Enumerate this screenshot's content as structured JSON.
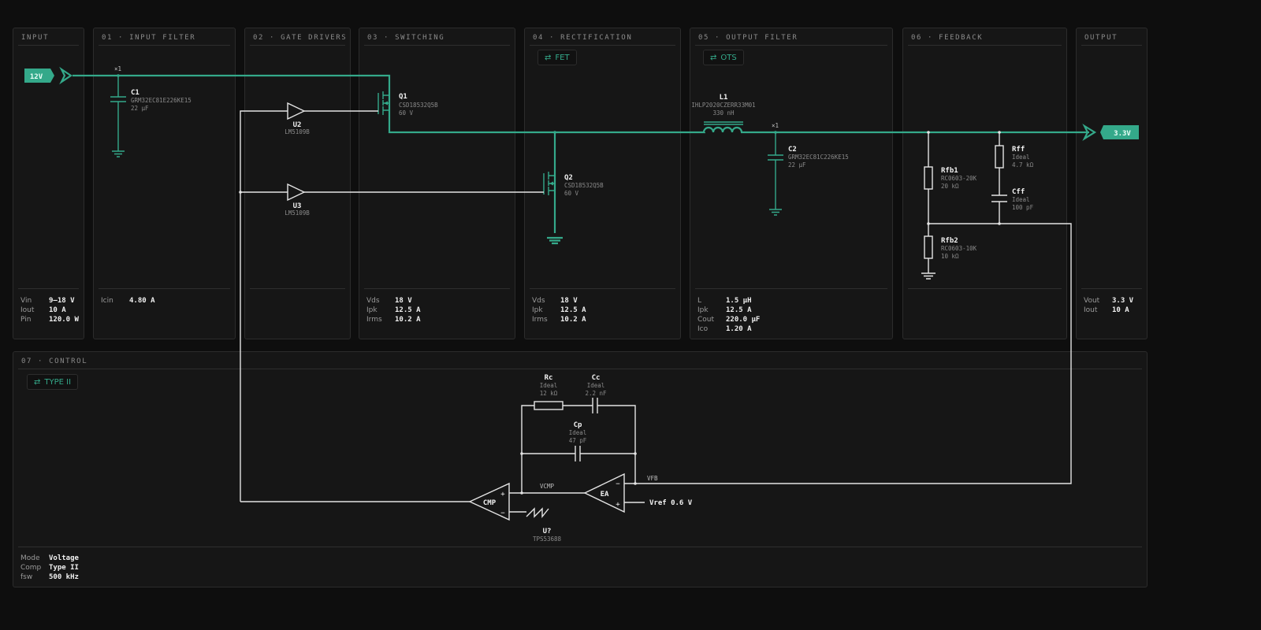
{
  "panels": {
    "input": {
      "title": "INPUT",
      "stats": [
        {
          "label": "Vin",
          "value": "9–18 V"
        },
        {
          "label": "Iout",
          "value": "10 A"
        },
        {
          "label": "Pin",
          "value": "120.0 W"
        }
      ]
    },
    "input_filter": {
      "title": "01 · INPUT FILTER",
      "stats": [
        {
          "label": "Icin",
          "value": "4.80 A"
        }
      ]
    },
    "gate_drivers": {
      "title": "02 · GATE DRIVERS"
    },
    "switching": {
      "title": "03 · SWITCHING",
      "stats": [
        {
          "label": "Vds",
          "value": "18 V"
        },
        {
          "label": "Ipk",
          "value": "12.5 A"
        },
        {
          "label": "Irms",
          "value": "10.2 A"
        }
      ]
    },
    "rectification": {
      "title": "04 · RECTIFICATION",
      "chip": "FET",
      "stats": [
        {
          "label": "Vds",
          "value": "18 V"
        },
        {
          "label": "Ipk",
          "value": "12.5 A"
        },
        {
          "label": "Irms",
          "value": "10.2 A"
        }
      ]
    },
    "output_filter": {
      "title": "05 · OUTPUT FILTER",
      "chip": "OTS",
      "stats": [
        {
          "label": "L",
          "value": "1.5 µH"
        },
        {
          "label": "Ipk",
          "value": "12.5 A"
        },
        {
          "label": "Cout",
          "value": "220.0 µF"
        },
        {
          "label": "Ico",
          "value": "1.20 A"
        }
      ]
    },
    "feedback": {
      "title": "06 · FEEDBACK"
    },
    "output": {
      "title": "OUTPUT",
      "stats": [
        {
          "label": "Vout",
          "value": "3.3 V"
        },
        {
          "label": "Iout",
          "value": "10 A"
        }
      ]
    },
    "control": {
      "title": "07 · CONTROL",
      "chip": "TYPE II",
      "stats": [
        {
          "label": "Mode",
          "value": "Voltage"
        },
        {
          "label": "Comp",
          "value": "Type II"
        },
        {
          "label": "fsw",
          "value": "500 kHz"
        }
      ]
    }
  },
  "ports": {
    "input": "12V",
    "output": "3.3V"
  },
  "components": {
    "C1": {
      "ref": "C1",
      "part": "GRM32EC81E226KE15",
      "value": "22 µF",
      "multiplier": "×1"
    },
    "U2": {
      "ref": "U2",
      "part": "LM5109B"
    },
    "U3": {
      "ref": "U3",
      "part": "LM5109B"
    },
    "Q1": {
      "ref": "Q1",
      "part": "CSD18532Q5B",
      "value": "60 V"
    },
    "Q2": {
      "ref": "Q2",
      "part": "CSD18532Q5B",
      "value": "60 V"
    },
    "L1": {
      "ref": "L1",
      "part": "IHLP2020CZERR33M01",
      "value": "330 nH"
    },
    "C2": {
      "ref": "C2",
      "part": "GRM32EC81C226KE15",
      "value": "22 µF",
      "multiplier": "×1"
    },
    "Rfb1": {
      "ref": "Rfb1",
      "part": "RC0603-20K",
      "value": "20 kΩ"
    },
    "Rfb2": {
      "ref": "Rfb2",
      "part": "RC0603-10K",
      "value": "10 kΩ"
    },
    "Rff": {
      "ref": "Rff",
      "part": "Ideal",
      "value": "4.7 kΩ"
    },
    "Cff": {
      "ref": "Cff",
      "part": "Ideal",
      "value": "100 pF"
    },
    "Rc": {
      "ref": "Rc",
      "part": "Ideal",
      "value": "12 kΩ"
    },
    "Cc": {
      "ref": "Cc",
      "part": "Ideal",
      "value": "2.2 nF"
    },
    "Cp": {
      "ref": "Cp",
      "part": "Ideal",
      "value": "47 pF"
    },
    "U7": {
      "ref": "U?",
      "part": "TPS53688"
    },
    "CMP": {
      "label": "CMP"
    },
    "EA": {
      "label": "EA"
    }
  },
  "nets": {
    "vcmp": "VCMP",
    "vfb": "VFB",
    "vref": "Vref 0.6 V"
  },
  "colors": {
    "power": "#34a98a",
    "signal": "#e4e4e4",
    "panel": "#161616",
    "border": "#2c2c2c"
  },
  "icons": {
    "swap": "swap-arrows-icon"
  }
}
